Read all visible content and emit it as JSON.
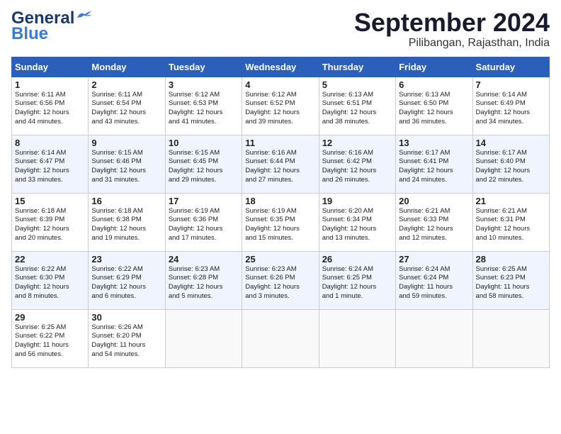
{
  "header": {
    "logo_line1": "General",
    "logo_line2": "Blue",
    "month": "September 2024",
    "location": "Pilibangan, Rajasthan, India"
  },
  "weekdays": [
    "Sunday",
    "Monday",
    "Tuesday",
    "Wednesday",
    "Thursday",
    "Friday",
    "Saturday"
  ],
  "weeks": [
    [
      {
        "day": "1",
        "info": "Sunrise: 6:11 AM\nSunset: 6:56 PM\nDaylight: 12 hours\nand 44 minutes."
      },
      {
        "day": "2",
        "info": "Sunrise: 6:11 AM\nSunset: 6:54 PM\nDaylight: 12 hours\nand 43 minutes."
      },
      {
        "day": "3",
        "info": "Sunrise: 6:12 AM\nSunset: 6:53 PM\nDaylight: 12 hours\nand 41 minutes."
      },
      {
        "day": "4",
        "info": "Sunrise: 6:12 AM\nSunset: 6:52 PM\nDaylight: 12 hours\nand 39 minutes."
      },
      {
        "day": "5",
        "info": "Sunrise: 6:13 AM\nSunset: 6:51 PM\nDaylight: 12 hours\nand 38 minutes."
      },
      {
        "day": "6",
        "info": "Sunrise: 6:13 AM\nSunset: 6:50 PM\nDaylight: 12 hours\nand 36 minutes."
      },
      {
        "day": "7",
        "info": "Sunrise: 6:14 AM\nSunset: 6:49 PM\nDaylight: 12 hours\nand 34 minutes."
      }
    ],
    [
      {
        "day": "8",
        "info": "Sunrise: 6:14 AM\nSunset: 6:47 PM\nDaylight: 12 hours\nand 33 minutes."
      },
      {
        "day": "9",
        "info": "Sunrise: 6:15 AM\nSunset: 6:46 PM\nDaylight: 12 hours\nand 31 minutes."
      },
      {
        "day": "10",
        "info": "Sunrise: 6:15 AM\nSunset: 6:45 PM\nDaylight: 12 hours\nand 29 minutes."
      },
      {
        "day": "11",
        "info": "Sunrise: 6:16 AM\nSunset: 6:44 PM\nDaylight: 12 hours\nand 27 minutes."
      },
      {
        "day": "12",
        "info": "Sunrise: 6:16 AM\nSunset: 6:42 PM\nDaylight: 12 hours\nand 26 minutes."
      },
      {
        "day": "13",
        "info": "Sunrise: 6:17 AM\nSunset: 6:41 PM\nDaylight: 12 hours\nand 24 minutes."
      },
      {
        "day": "14",
        "info": "Sunrise: 6:17 AM\nSunset: 6:40 PM\nDaylight: 12 hours\nand 22 minutes."
      }
    ],
    [
      {
        "day": "15",
        "info": "Sunrise: 6:18 AM\nSunset: 6:39 PM\nDaylight: 12 hours\nand 20 minutes."
      },
      {
        "day": "16",
        "info": "Sunrise: 6:18 AM\nSunset: 6:38 PM\nDaylight: 12 hours\nand 19 minutes."
      },
      {
        "day": "17",
        "info": "Sunrise: 6:19 AM\nSunset: 6:36 PM\nDaylight: 12 hours\nand 17 minutes."
      },
      {
        "day": "18",
        "info": "Sunrise: 6:19 AM\nSunset: 6:35 PM\nDaylight: 12 hours\nand 15 minutes."
      },
      {
        "day": "19",
        "info": "Sunrise: 6:20 AM\nSunset: 6:34 PM\nDaylight: 12 hours\nand 13 minutes."
      },
      {
        "day": "20",
        "info": "Sunrise: 6:21 AM\nSunset: 6:33 PM\nDaylight: 12 hours\nand 12 minutes."
      },
      {
        "day": "21",
        "info": "Sunrise: 6:21 AM\nSunset: 6:31 PM\nDaylight: 12 hours\nand 10 minutes."
      }
    ],
    [
      {
        "day": "22",
        "info": "Sunrise: 6:22 AM\nSunset: 6:30 PM\nDaylight: 12 hours\nand 8 minutes."
      },
      {
        "day": "23",
        "info": "Sunrise: 6:22 AM\nSunset: 6:29 PM\nDaylight: 12 hours\nand 6 minutes."
      },
      {
        "day": "24",
        "info": "Sunrise: 6:23 AM\nSunset: 6:28 PM\nDaylight: 12 hours\nand 5 minutes."
      },
      {
        "day": "25",
        "info": "Sunrise: 6:23 AM\nSunset: 6:26 PM\nDaylight: 12 hours\nand 3 minutes."
      },
      {
        "day": "26",
        "info": "Sunrise: 6:24 AM\nSunset: 6:25 PM\nDaylight: 12 hours\nand 1 minute."
      },
      {
        "day": "27",
        "info": "Sunrise: 6:24 AM\nSunset: 6:24 PM\nDaylight: 11 hours\nand 59 minutes."
      },
      {
        "day": "28",
        "info": "Sunrise: 6:25 AM\nSunset: 6:23 PM\nDaylight: 11 hours\nand 58 minutes."
      }
    ],
    [
      {
        "day": "29",
        "info": "Sunrise: 6:25 AM\nSunset: 6:22 PM\nDaylight: 11 hours\nand 56 minutes."
      },
      {
        "day": "30",
        "info": "Sunrise: 6:26 AM\nSunset: 6:20 PM\nDaylight: 11 hours\nand 54 minutes."
      },
      {
        "day": "",
        "info": ""
      },
      {
        "day": "",
        "info": ""
      },
      {
        "day": "",
        "info": ""
      },
      {
        "day": "",
        "info": ""
      },
      {
        "day": "",
        "info": ""
      }
    ]
  ]
}
